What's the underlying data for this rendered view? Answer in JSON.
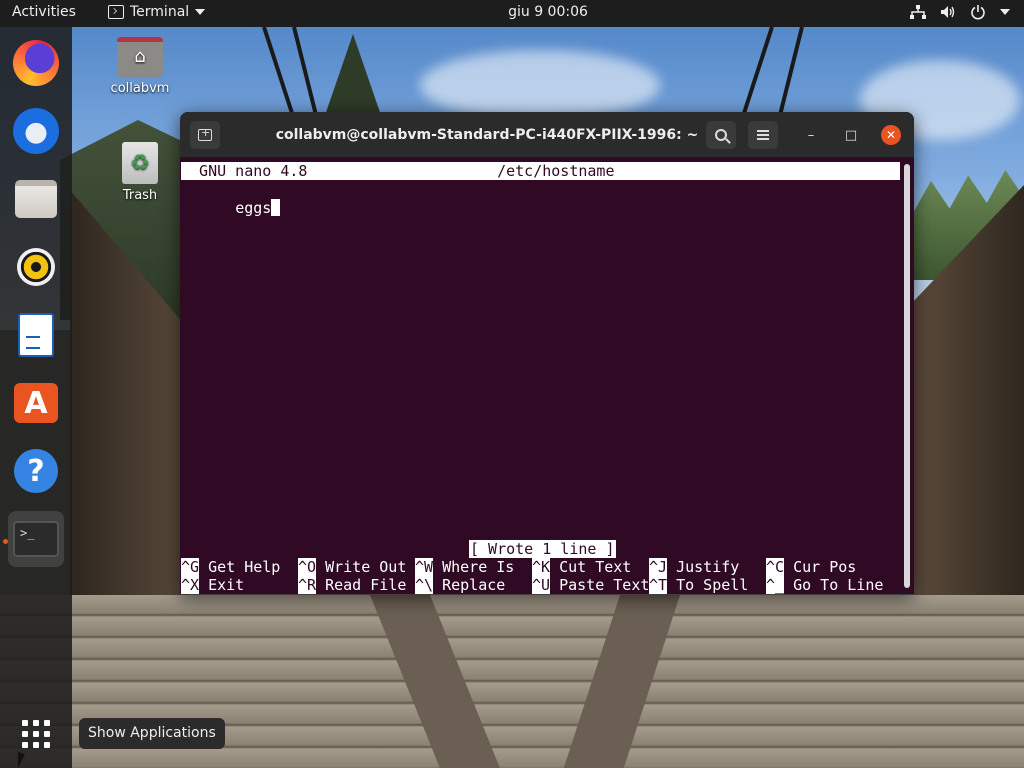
{
  "topbar": {
    "activities": "Activities",
    "app_name": "Terminal",
    "clock": "giu 9  00:06"
  },
  "desktop": {
    "icons": [
      {
        "label": "collabvm"
      },
      {
        "label": "Trash"
      }
    ]
  },
  "dock": {
    "items": [
      "firefox-icon",
      "thunderbird-icon",
      "files-icon",
      "rhythmbox-icon",
      "libreoffice-writer-icon",
      "ubuntu-software-icon",
      "help-icon",
      "terminal-icon"
    ],
    "apps_tooltip": "Show Applications"
  },
  "terminal": {
    "title": "collabvm@collabvm-Standard-PC-i440FX-PIIX-1996: ~",
    "nano": {
      "header": "  GNU nano 4.8                     /etc/hostname",
      "content": "eggs",
      "status": "[ Wrote 1 line ]",
      "shortcuts_row1": [
        {
          "key": "^G",
          "label": " Get Help"
        },
        {
          "key": "^O",
          "label": " Write Out"
        },
        {
          "key": "^W",
          "label": " Where Is"
        },
        {
          "key": "^K",
          "label": " Cut Text"
        },
        {
          "key": "^J",
          "label": " Justify"
        },
        {
          "key": "^C",
          "label": " Cur Pos"
        }
      ],
      "shortcuts_row2": [
        {
          "key": "^X",
          "label": " Exit"
        },
        {
          "key": "^R",
          "label": " Read File"
        },
        {
          "key": "^\\",
          "label": " Replace"
        },
        {
          "key": "^U",
          "label": " Paste Text"
        },
        {
          "key": "^T",
          "label": " To Spell"
        },
        {
          "key": "^_",
          "label": " Go To Line"
        }
      ]
    }
  },
  "colors": {
    "terminal_bg": "#300a24",
    "accent": "#e95420",
    "panel": "#1d1d1d"
  }
}
